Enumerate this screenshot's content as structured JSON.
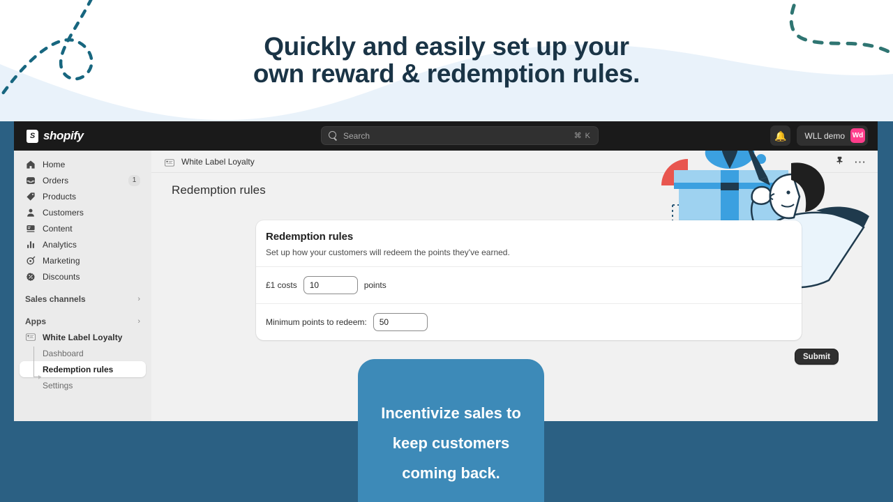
{
  "promo": {
    "headline_line1": "Quickly and easily set up your",
    "headline_line2": "own reward & redemption rules.",
    "title_color": "#1a3446",
    "wave_color": "#e9f2fa",
    "deco_color_left": "#17667f",
    "deco_color_right": "#2f7572"
  },
  "topbar": {
    "brand": "shopify",
    "logo_icon": "shopify-bag-icon",
    "search": {
      "icon": "search-icon",
      "placeholder": "Search",
      "shortcut": "⌘ K"
    },
    "notifications_icon": "bell-icon",
    "store_name": "WLL demo",
    "avatar_initials": "Wd",
    "avatar_color": "#ff3d8b"
  },
  "sidebar": {
    "items": [
      {
        "label": "Home",
        "icon": "home-icon",
        "badge": ""
      },
      {
        "label": "Orders",
        "icon": "orders-inbox-icon",
        "badge": "1"
      },
      {
        "label": "Products",
        "icon": "tag-icon",
        "badge": ""
      },
      {
        "label": "Customers",
        "icon": "person-icon",
        "badge": ""
      },
      {
        "label": "Content",
        "icon": "content-icon",
        "badge": ""
      },
      {
        "label": "Analytics",
        "icon": "bar-chart-icon",
        "badge": ""
      },
      {
        "label": "Marketing",
        "icon": "megaphone-target-icon",
        "badge": ""
      },
      {
        "label": "Discounts",
        "icon": "discount-tag-icon",
        "badge": ""
      }
    ],
    "sections": [
      {
        "label": "Sales channels",
        "chevron": "chevron-right-icon"
      },
      {
        "label": "Apps",
        "chevron": "chevron-right-icon"
      }
    ],
    "app": {
      "label": "White Label Loyalty",
      "icon": "app-grid-icon"
    },
    "app_children": [
      {
        "label": "Dashboard",
        "selected": false
      },
      {
        "label": "Redemption rules",
        "selected": true
      },
      {
        "label": "Settings",
        "selected": false
      }
    ]
  },
  "content": {
    "breadcrumb": {
      "icon": "app-grid-icon",
      "label": "White Label Loyalty"
    },
    "actions": {
      "pin_icon": "pin-icon",
      "more_icon": "ellipsis-icon"
    },
    "page_title": "Redemption rules",
    "card": {
      "title": "Redemption rules",
      "subtitle": "Set up how your customers will redeem the points they've earned.",
      "rows": [
        {
          "label_before": "£1 costs",
          "value": "10",
          "label_after": "points"
        },
        {
          "label_before": "Minimum points to redeem:",
          "value": "50",
          "label_after": ""
        }
      ]
    },
    "submit_label": "Submit",
    "illustration": "person-with-pen-and-giftbox-illustration"
  },
  "callout": {
    "text": "Incentivize sales to keep customers coming back.",
    "background": "#3d8ab8",
    "text_color": "#ffffff"
  },
  "page": {
    "background": "#2b6083"
  }
}
